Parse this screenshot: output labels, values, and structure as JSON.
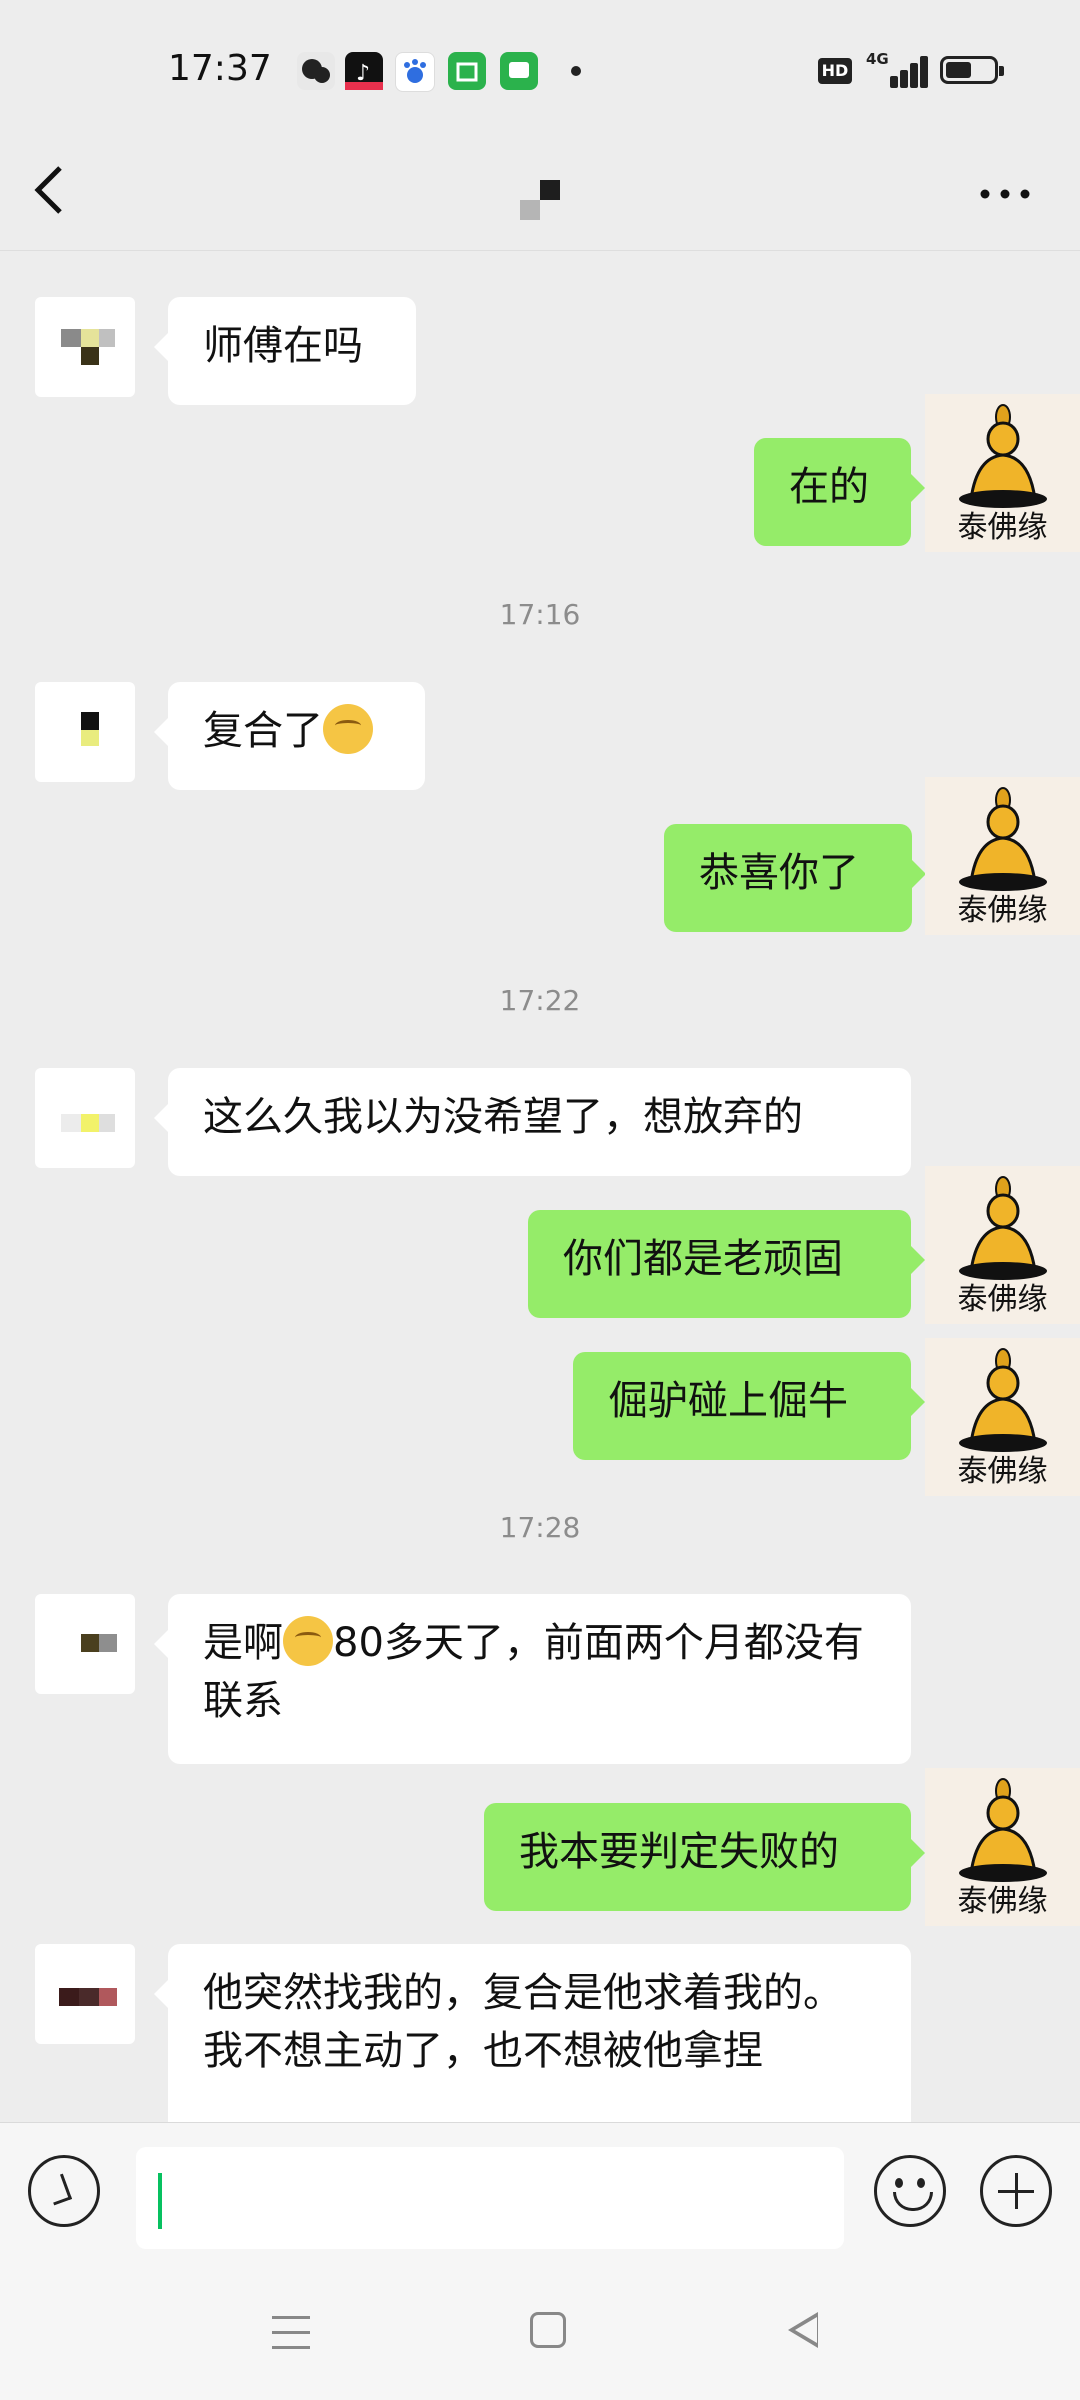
{
  "status_bar": {
    "time": "17:37",
    "hd": "HD",
    "network": "4G",
    "app_icons": [
      "wechat-icon",
      "tiktok-icon",
      "baidu-icon",
      "shop-icon",
      "chat-app-icon"
    ],
    "battery_percent": 55
  },
  "header": {
    "back_icon": "chevron-left-icon",
    "more_icon": "more-dots-icon"
  },
  "messages": [
    {
      "dir": "in",
      "text": "师傅在吗"
    },
    {
      "dir": "out",
      "text": "在的"
    },
    {
      "type": "timestamp",
      "text": "17:16"
    },
    {
      "dir": "in",
      "text": "复合了",
      "emoji": "hand-over-mouth-emoji"
    },
    {
      "dir": "out",
      "text": "恭喜你了"
    },
    {
      "type": "timestamp",
      "text": "17:22"
    },
    {
      "dir": "in",
      "text": "这么久我以为没希望了，想放弃的"
    },
    {
      "dir": "out",
      "text": "你们都是老顽固"
    },
    {
      "dir": "out",
      "text": "倔驴碰上倔牛"
    },
    {
      "type": "timestamp",
      "text": "17:28"
    },
    {
      "dir": "in",
      "text_lead": "是啊",
      "emoji": "crying-laughing-emoji",
      "text": "80多天了，前面两个月都没有联系"
    },
    {
      "dir": "out",
      "text": "我本要判定失败的"
    },
    {
      "dir": "in",
      "text": "他突然找我的，复合是他求着我的。我不想主动了，也不想被他拿捏"
    }
  ],
  "sender_avatar_label": "泰佛缘",
  "input": {
    "value": ""
  },
  "colors": {
    "background": "#ededed",
    "outgoing_bubble": "#95ec69",
    "incoming_bubble": "#ffffff",
    "caret": "#07c160"
  }
}
